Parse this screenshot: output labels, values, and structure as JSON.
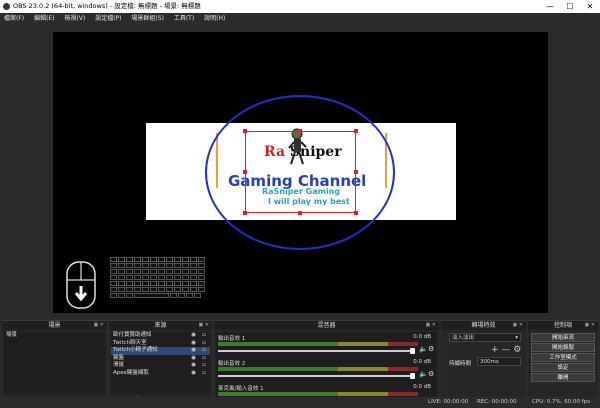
{
  "window": {
    "title": "OBS 23.0.2 (64-bit, windows) - 設定檔: 無標題 - 場景: 無標題",
    "minimize": "—",
    "maximize": "☐",
    "close": "✕"
  },
  "menu": [
    "檔案(F)",
    "編輯(E)",
    "檢視(V)",
    "設定檔(P)",
    "場景群組(S)",
    "工具(T)",
    "說明(H)"
  ],
  "preview": {
    "banner_title_red": "Ra",
    "banner_title_rest": " Sniper",
    "banner_heading": "Gaming Channel",
    "banner_sub1": "RaSniper Gaming",
    "banner_sub2": "I will play my best"
  },
  "docks": {
    "scenes": {
      "title": "場景",
      "items": [
        "場景"
      ]
    },
    "sources": {
      "title": "來源",
      "items": [
        {
          "label": "歐付寶贊助通知",
          "selected": false
        },
        {
          "label": "Twitch聊天室",
          "selected": false
        },
        {
          "label": "Twitch小精子通知",
          "selected": true
        },
        {
          "label": "鍵盤",
          "selected": false
        },
        {
          "label": "滑鼠",
          "selected": false
        },
        {
          "label": "Apex鍵盤擷取",
          "selected": false
        }
      ]
    },
    "mixer": {
      "title": "混音器",
      "channels": [
        {
          "name": "輸出音效 1",
          "db": "0.0 dB"
        },
        {
          "name": "輸出音效 2",
          "db": "0.0 dB"
        },
        {
          "name": "麥克風/輸入音效 1",
          "db": "0.0 dB"
        }
      ]
    },
    "transitions": {
      "title": "轉場特效",
      "selected": "淡入淡出",
      "duration_label": "持續時間",
      "duration_value": "300ms"
    },
    "controls": {
      "title": "控制項",
      "buttons": [
        "開始串流",
        "開始錄製",
        "工作室模式",
        "設定",
        "離開"
      ]
    }
  },
  "status": {
    "live": "LIVE: 00:00:00",
    "rec": "REC: 00:00:00",
    "cpu": "CPU: 0.7%, 60.00 fps"
  },
  "icons": {
    "eye": "eye-icon",
    "lock": "lock-icon",
    "add": "plus-icon",
    "remove": "minus-icon",
    "up": "arrow-up-icon",
    "down": "arrow-down-icon",
    "gear": "gear-icon"
  }
}
